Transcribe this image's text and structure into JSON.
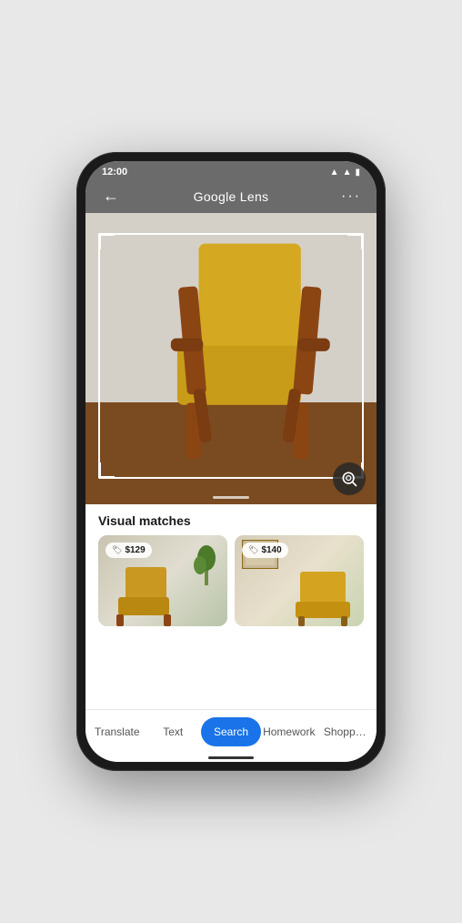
{
  "statusBar": {
    "time": "12:00",
    "wifiIcon": "▲",
    "batteryIcon": "▮"
  },
  "topBar": {
    "backLabel": "←",
    "titlePrefix": "Google",
    "titleSuffix": " Lens",
    "moreLabel": "···"
  },
  "imageSection": {
    "altText": "Yellow mid-century modern armchair with wooden legs against white wall on dark wood floor"
  },
  "resultsSection": {
    "sectionTitle": "Visual matches",
    "matches": [
      {
        "price": "$129"
      },
      {
        "price": "$140"
      }
    ]
  },
  "bottomTabs": {
    "items": [
      {
        "label": "Translate",
        "active": false
      },
      {
        "label": "Text",
        "active": false
      },
      {
        "label": "Search",
        "active": true
      },
      {
        "label": "Homework",
        "active": false
      },
      {
        "label": "Shopp…",
        "active": false
      }
    ]
  },
  "colors": {
    "activeTab": "#1a73e8",
    "activeTabText": "#ffffff",
    "inactiveTabText": "#555555",
    "priceBadgeBg": "rgba(255,255,255,0.9)"
  }
}
